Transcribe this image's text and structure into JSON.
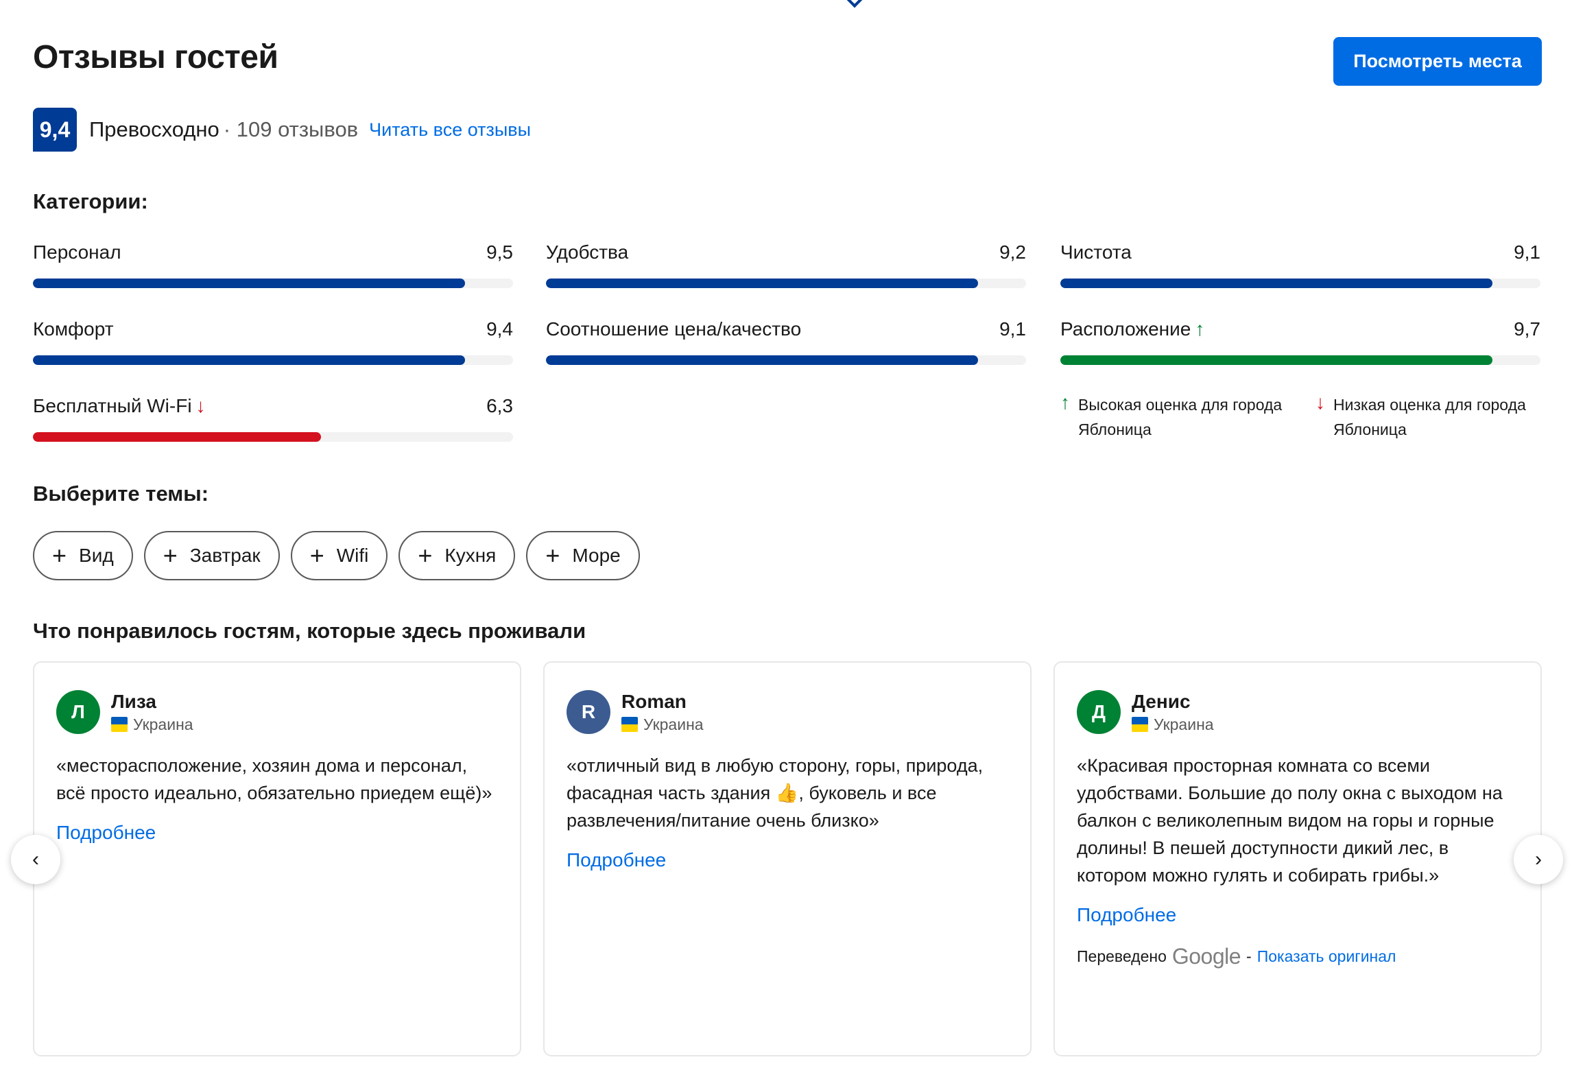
{
  "header": {
    "title": "Отзывы гостей",
    "see_places_label": "Посмотреть места"
  },
  "summary": {
    "score": "9,4",
    "word": "Превосходно",
    "count": "· 109 отзывов",
    "read_all": "Читать все отзывы"
  },
  "categories": {
    "heading": "Категории:",
    "items": [
      {
        "label": "Персонал",
        "score": "9,5",
        "fraction": 0.9,
        "color": "#003b95"
      },
      {
        "label": "Удобства",
        "score": "9,2",
        "fraction": 0.9,
        "color": "#003b95"
      },
      {
        "label": "Чистота",
        "score": "9,1",
        "fraction": 0.9,
        "color": "#003b95"
      },
      {
        "label": "Комфорт",
        "score": "9,4",
        "fraction": 0.9,
        "color": "#003b95"
      },
      {
        "label": "Соотношение цена/качество",
        "score": "9,1",
        "fraction": 0.9,
        "color": "#003b95"
      },
      {
        "label": "Расположение",
        "score": "9,7",
        "fraction": 0.9,
        "color": "#008234",
        "trend": "up"
      },
      {
        "label": "Бесплатный Wi-Fi",
        "score": "6,3",
        "fraction": 0.6,
        "color": "#d4111e",
        "trend": "down"
      }
    ],
    "legend": {
      "high": "Высокая оценка для города Яблоница",
      "low": "Низкая оценка для города Яблоница"
    }
  },
  "topics": {
    "heading": "Выберите темы:",
    "chips": [
      "Вид",
      "Завтрак",
      "Wifi",
      "Кухня",
      "Море"
    ]
  },
  "liked": {
    "heading": "Что понравилось гостям, которые здесь проживали",
    "more_label": "Подробнее",
    "reviews": [
      {
        "initial": "Л",
        "avatar_color": "#008234",
        "name": "Лиза",
        "country": "Украина",
        "text": "«месторасположение, хозяин дома и персонал, всё просто идеально, обязательно приедем ещё)»"
      },
      {
        "initial": "R",
        "avatar_color": "#3b5b91",
        "name": "Roman",
        "country": "Украина",
        "text": "«отличный вид в любую сторону, горы, природа, фасадная часть здания 👍, буковель и все развлечения/питание очень близко»"
      },
      {
        "initial": "Д",
        "avatar_color": "#008234",
        "name": "Денис",
        "country": "Украина",
        "text": "«Красивая просторная комната со всеми удобствами. Большие до полу окна с выходом на балкон с великолепным видом на горы и горные долины! В пешей доступности дикий лес, в котором можно гулять и собирать грибы.»"
      }
    ],
    "translated_prefix": "Переведено",
    "translator": "Google",
    "show_original": "Показать оригинал"
  },
  "carousel": {
    "prev_icon": "chevron-left-icon",
    "next_icon": "chevron-right-icon"
  }
}
